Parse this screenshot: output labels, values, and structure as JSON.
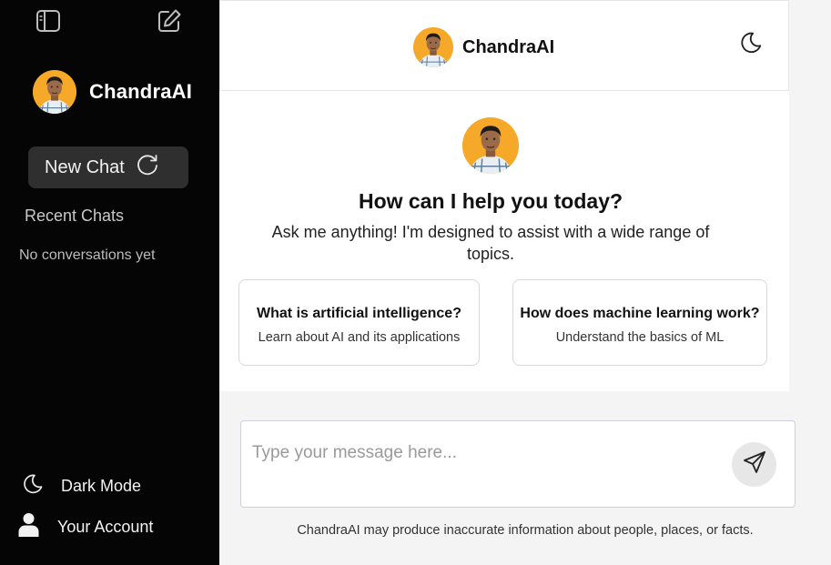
{
  "sidebar": {
    "brand_name": "ChandraAI",
    "new_chat_label": "New Chat",
    "recent_chats_title": "Recent Chats",
    "empty_state": "No conversations yet",
    "dark_mode_label": "Dark Mode",
    "account_label": "Your Account",
    "icons": [
      "sidebar-toggle-icon",
      "edit-icon",
      "refresh-icon",
      "moon-icon",
      "user-icon"
    ]
  },
  "header": {
    "brand_name": "ChandraAI",
    "theme_icon": "moon-icon"
  },
  "welcome": {
    "title": "How can I help you today?",
    "subtitle": "Ask me anything! I'm designed to assist with a wide range of topics.",
    "suggestions": [
      {
        "question": "What is artificial intelligence?",
        "description": "Learn about AI and its applications"
      },
      {
        "question": "How does machine learning work?",
        "description": "Understand the basics of ML"
      }
    ]
  },
  "composer": {
    "placeholder": "Type your message here...",
    "send_icon": "send-icon"
  },
  "disclaimer": "ChandraAI may produce inaccurate information about people, places, or facts.",
  "colors": {
    "sidebar_bg": "#050505",
    "avatar_bg": "#f6a928",
    "new_chat_bg": "#2f2f2f",
    "page_bg": "#f4f4f4"
  }
}
